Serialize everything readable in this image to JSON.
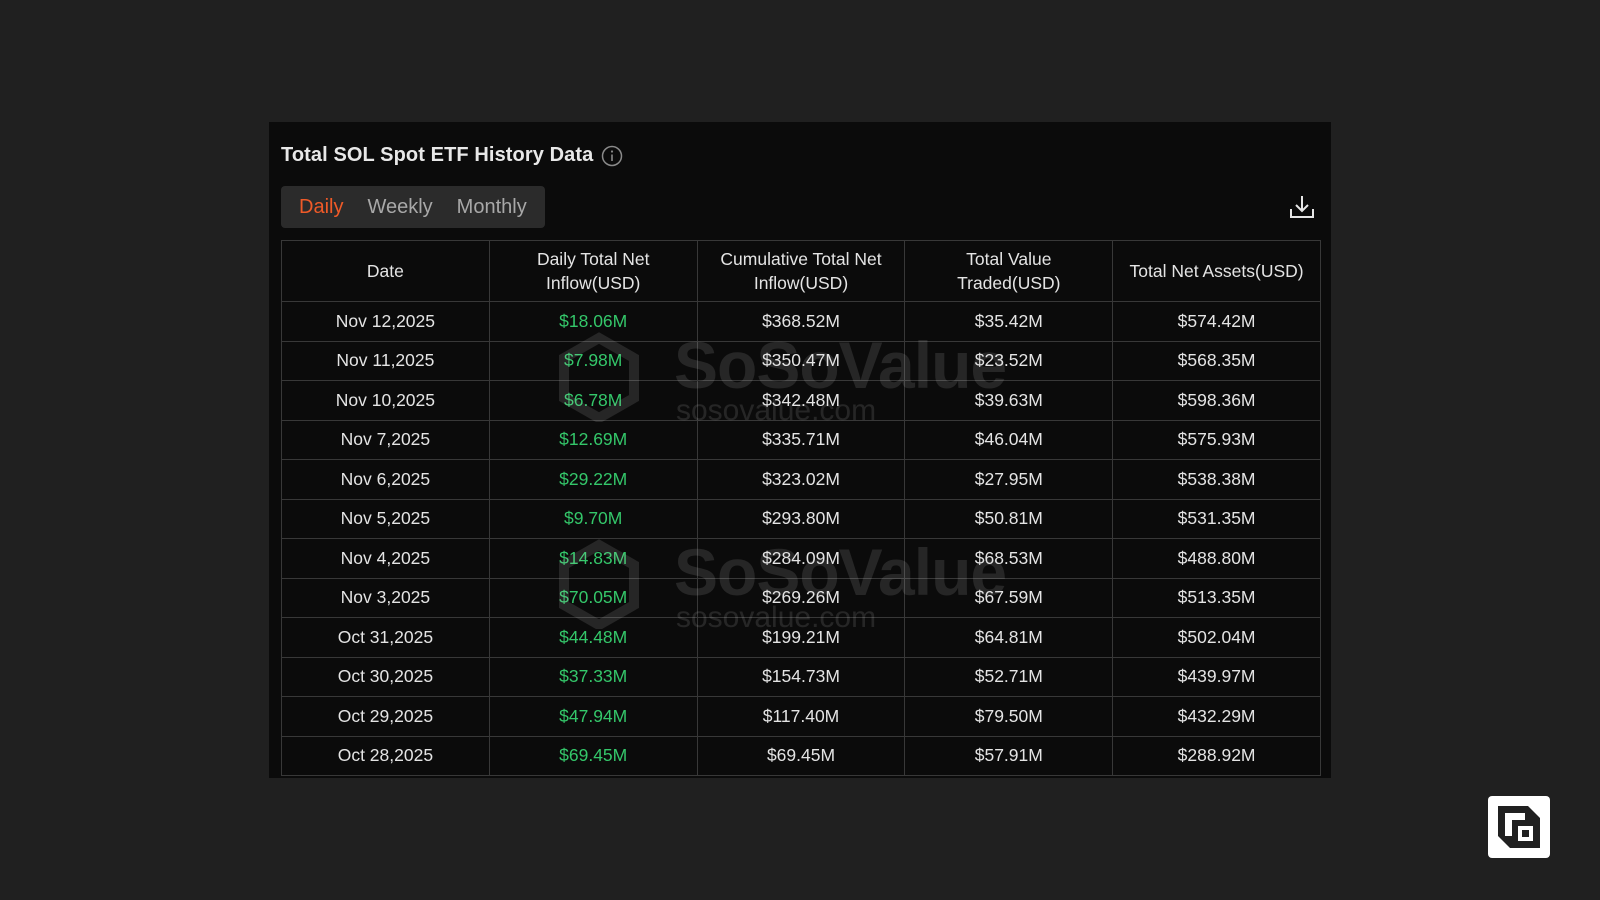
{
  "title": "Total SOL Spot ETF History Data",
  "tabs": [
    {
      "label": "Daily",
      "active": true
    },
    {
      "label": "Weekly",
      "active": false
    },
    {
      "label": "Monthly",
      "active": false
    }
  ],
  "icons": {
    "info": "info-icon",
    "download": "download-icon",
    "corner": "brand-logo-icon"
  },
  "colors": {
    "accent": "#ef5a28",
    "positive": "#34c76a"
  },
  "watermark": {
    "brand": "SoSoValue",
    "url": "sosovalue.com"
  },
  "table": {
    "headers": [
      "Date",
      "Daily Total Net Inflow(USD)",
      "Cumulative Total Net Inflow(USD)",
      "Total Value Traded(USD)",
      "Total Net Assets(USD)"
    ],
    "rows": [
      [
        "Nov 12,2025",
        "$18.06M",
        "$368.52M",
        "$35.42M",
        "$574.42M"
      ],
      [
        "Nov 11,2025",
        "$7.98M",
        "$350.47M",
        "$23.52M",
        "$568.35M"
      ],
      [
        "Nov 10,2025",
        "$6.78M",
        "$342.48M",
        "$39.63M",
        "$598.36M"
      ],
      [
        "Nov 7,2025",
        "$12.69M",
        "$335.71M",
        "$46.04M",
        "$575.93M"
      ],
      [
        "Nov 6,2025",
        "$29.22M",
        "$323.02M",
        "$27.95M",
        "$538.38M"
      ],
      [
        "Nov 5,2025",
        "$9.70M",
        "$293.80M",
        "$50.81M",
        "$531.35M"
      ],
      [
        "Nov 4,2025",
        "$14.83M",
        "$284.09M",
        "$68.53M",
        "$488.80M"
      ],
      [
        "Nov 3,2025",
        "$70.05M",
        "$269.26M",
        "$67.59M",
        "$513.35M"
      ],
      [
        "Oct 31,2025",
        "$44.48M",
        "$199.21M",
        "$64.81M",
        "$502.04M"
      ],
      [
        "Oct 30,2025",
        "$37.33M",
        "$154.73M",
        "$52.71M",
        "$439.97M"
      ],
      [
        "Oct 29,2025",
        "$47.94M",
        "$117.40M",
        "$79.50M",
        "$432.29M"
      ],
      [
        "Oct 28,2025",
        "$69.45M",
        "$69.45M",
        "$57.91M",
        "$288.92M"
      ]
    ]
  }
}
